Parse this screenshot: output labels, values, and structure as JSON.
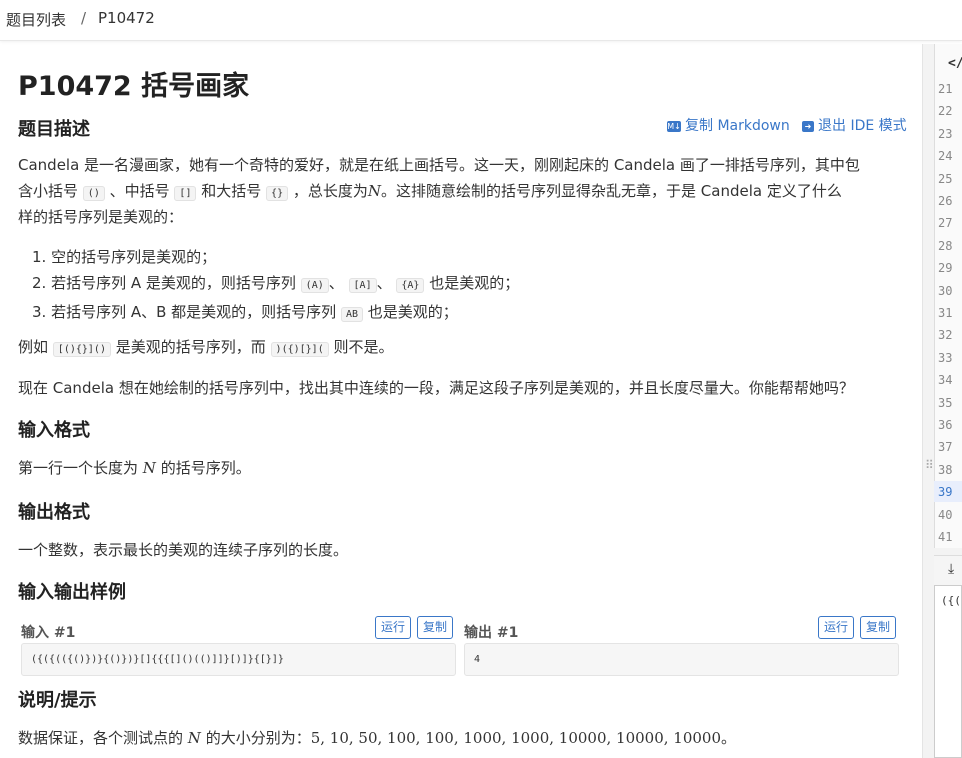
{
  "breadcrumb": {
    "root": "题目列表",
    "sep": "/",
    "current": "P10472"
  },
  "problem": {
    "title": "P10472 括号画家"
  },
  "actions": {
    "copy_markdown": "复制 Markdown",
    "exit_ide": "退出 IDE 模式"
  },
  "sections": {
    "description": "题目描述",
    "input_format": "输入格式",
    "output_format": "输出格式",
    "samples": "输入输出样例",
    "hint": "说明/提示"
  },
  "description": {
    "p1_l1_a": "Candela 是一名漫画家，她有一个奇特的爱好，就是在纸上画括号。这一天，刚刚起床的 Candela 画了一排括号序列，其中包",
    "p1_l2_a": "含小括号",
    "code_paren": "()",
    "p1_l2_b": "、中括号",
    "code_bracket": "[]",
    "p1_l2_c": "和大括号",
    "code_brace": "{}",
    "p1_l2_d": "，总长度为",
    "var_n": "N",
    "p1_l2_e": "。这排随意绘制的括号序列显得杂乱无章，于是 Candela 定义了什么",
    "p1_l3": "样的括号序列是美观的：",
    "li1": "1. 空的括号序列是美观的；",
    "li2_a": "2. 若括号序列 A 是美观的，则括号序列",
    "code_A1": "(A)",
    "li2_b": "、",
    "code_A2": "[A]",
    "li2_c": "、",
    "code_A3": "{A}",
    "li2_d": "也是美观的；",
    "li3_a": "3. 若括号序列 A、B 都是美观的，则括号序列",
    "code_AB": "AB",
    "li3_b": "也是美观的；",
    "ex_a": "例如",
    "code_ex1": "[(){}]()",
    "ex_b": "是美观的括号序列，而",
    "code_ex2": ")({)[}](",
    "ex_c": "则不是。",
    "p_last": "现在 Candela 想在她绘制的括号序列中，找出其中连续的一段，满足这段子序列是美观的，并且长度尽量大。你能帮帮她吗？"
  },
  "input_format": {
    "a": "第一行一个长度为",
    "var": "N",
    "b": "的括号序列。"
  },
  "output_format": {
    "text": "一个整数，表示最长的美观的连续子序列的长度。"
  },
  "samples": {
    "input_label": "输入 #1",
    "output_label": "输出 #1",
    "run": "运行",
    "copy": "复制",
    "input_value": "({({(({()})}{()})}[]{{{[]()(()]]}[)]}{[}]}",
    "output_value": "4"
  },
  "hint": {
    "a": "数据保证，各个测试点的",
    "var": "N",
    "b": "的大小分别为：",
    "values": "5, 10, 50, 100, 100, 1000, 1000, 10000, 10000, 10000",
    "c": "。"
  },
  "editor": {
    "tab_icon": "</",
    "line_numbers": [
      "21",
      "22",
      "23",
      "24",
      "25",
      "26",
      "27",
      "28",
      "29",
      "30",
      "31",
      "32",
      "33",
      "34",
      "35",
      "36",
      "37",
      "38",
      "39",
      "40",
      "41"
    ],
    "current_line": "39",
    "io_preview": "({("
  },
  "colors": {
    "accent": "#3a77c8",
    "text": "#333333"
  }
}
